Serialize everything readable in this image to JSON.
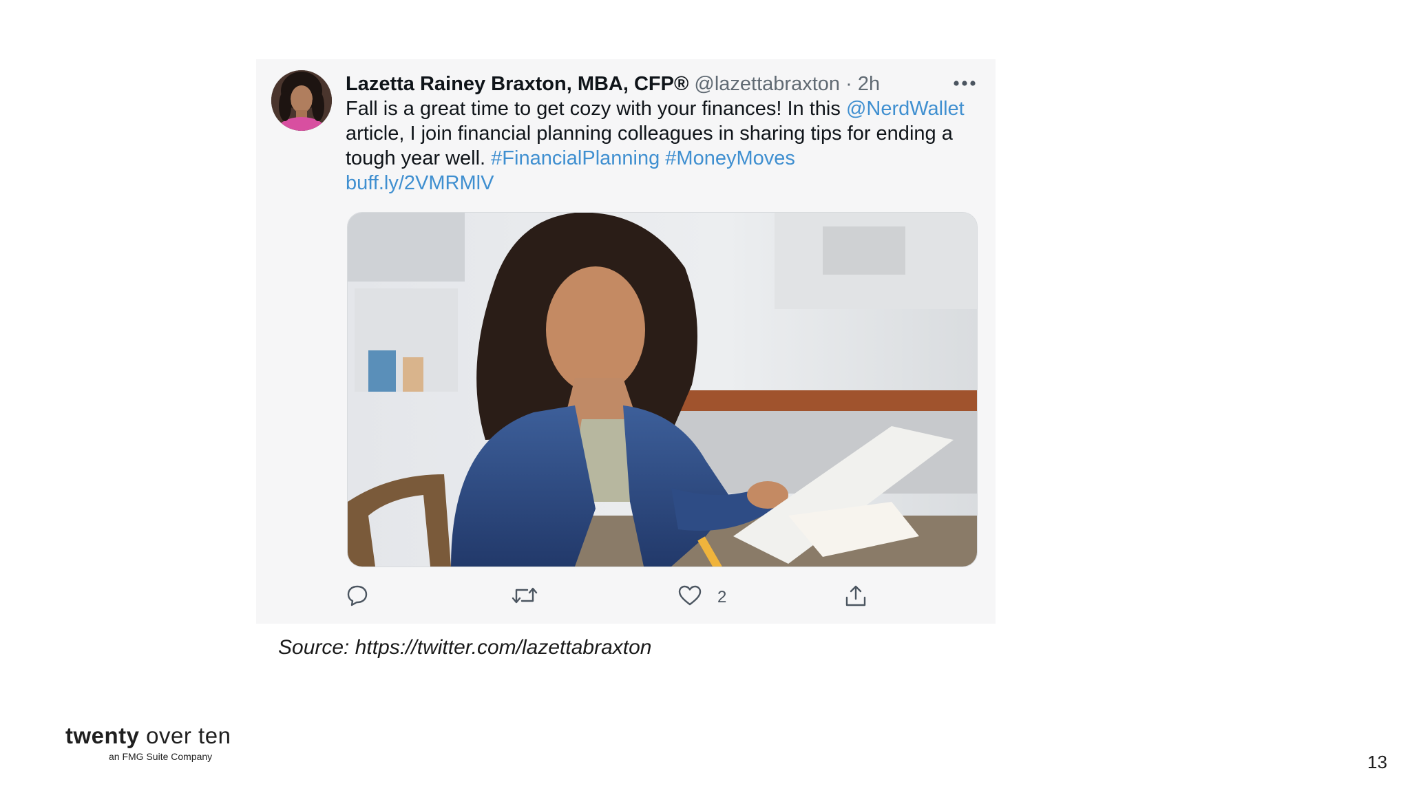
{
  "tweet": {
    "author_name": "Lazetta Rainey Braxton, MBA, CFP®",
    "handle": "@lazettabraxton",
    "separator": "·",
    "time": "2h",
    "text_part1": "Fall is a great time to get cozy with your finances! In this ",
    "mention": "@NerdWallet",
    "text_part2": " article, I join financial planning colleagues in sharing tips for ending a tough year well.  ",
    "hashtag1": "#FinancialPlanning",
    "hashtag2": "#MoneyMoves",
    "link": "buff.ly/2VMRMlV",
    "like_count": "2",
    "icons": [
      "more-icon",
      "reply-icon",
      "retweet-icon",
      "heart-icon",
      "share-icon"
    ],
    "link_color": "#3f8fd0"
  },
  "source": "Source: https://twitter.com/lazettabraxton",
  "logo": {
    "brand_bold": "twenty",
    "brand_rest": " over ten",
    "tagline": "an FMG Suite Company"
  },
  "page_number": "13"
}
